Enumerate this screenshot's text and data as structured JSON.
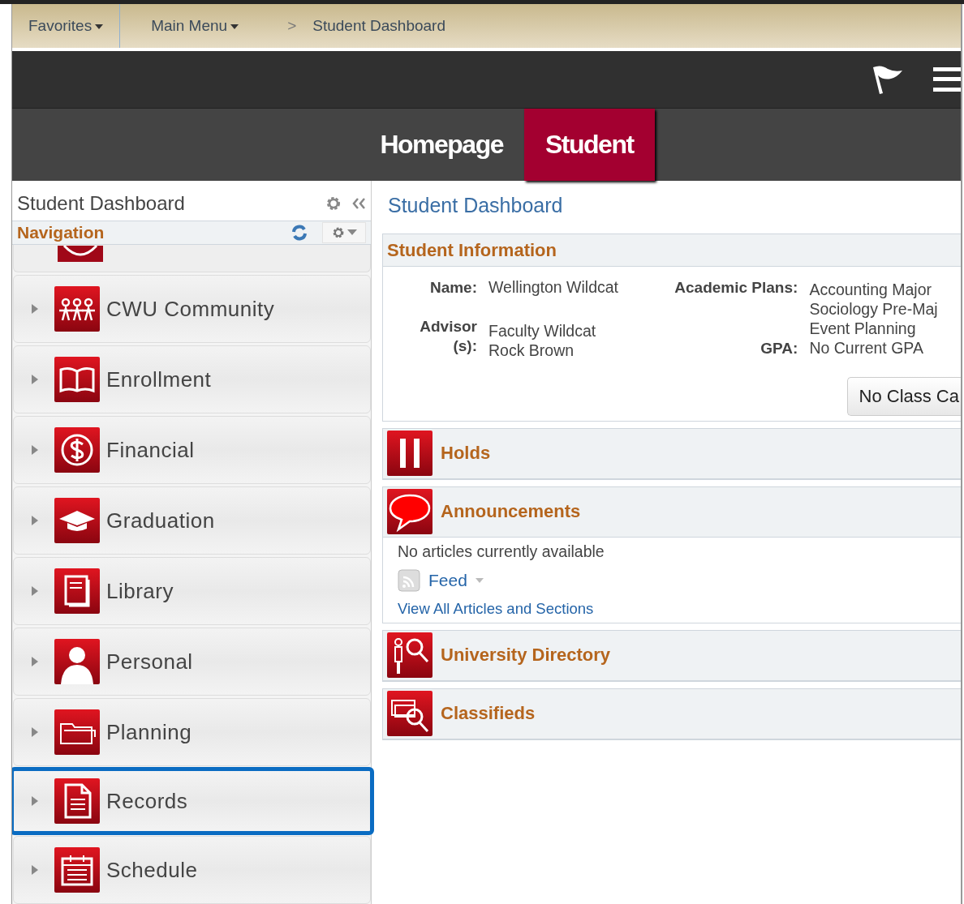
{
  "breadcrumb": {
    "favorites": "Favorites",
    "main_menu": "Main Menu",
    "separator": ">",
    "current": "Student Dashboard"
  },
  "tabs": [
    {
      "label": "Homepage",
      "selected": false
    },
    {
      "label": "Student",
      "selected": true
    }
  ],
  "left_panel": {
    "title": "Student Dashboard",
    "navigation_title": "Navigation",
    "items": [
      {
        "kind": "community",
        "label": "CWU Community",
        "selected": false
      },
      {
        "kind": "enrollment",
        "label": "Enrollment",
        "selected": false
      },
      {
        "kind": "financial",
        "label": "Financial",
        "selected": false
      },
      {
        "kind": "graduation",
        "label": "Graduation",
        "selected": false
      },
      {
        "kind": "library",
        "label": "Library",
        "selected": false
      },
      {
        "kind": "personal",
        "label": "Personal",
        "selected": false
      },
      {
        "kind": "planning",
        "label": "Planning",
        "selected": false
      },
      {
        "kind": "records",
        "label": "Records",
        "selected": true
      },
      {
        "kind": "schedule",
        "label": "Schedule",
        "selected": false
      }
    ]
  },
  "main": {
    "title": "Student Dashboard",
    "student_information": {
      "title": "Student Information",
      "left_fields": [
        {
          "label": "Name:",
          "values": [
            "Wellington Wildcat"
          ]
        },
        {
          "label": "Advisor\n(s):",
          "values": [
            "Faculty Wildcat",
            "Rock Brown"
          ]
        }
      ],
      "right_fields": [
        {
          "label": "Academic Plans:",
          "values": [
            "Accounting Major",
            "Sociology Pre-Maj",
            "Event Planning"
          ]
        },
        {
          "label": "GPA:",
          "values": [
            "No Current GPA"
          ]
        }
      ],
      "button": "No Class Ca"
    },
    "sections": [
      {
        "kind": "holds",
        "title": "Holds"
      },
      {
        "kind": "announcements",
        "title": "Announcements",
        "message": "No articles currently available",
        "feed": "Feed",
        "link": "View All Articles and Sections"
      },
      {
        "kind": "directory",
        "title": "University Directory"
      },
      {
        "kind": "classifieds",
        "title": "Classifieds"
      }
    ]
  }
}
